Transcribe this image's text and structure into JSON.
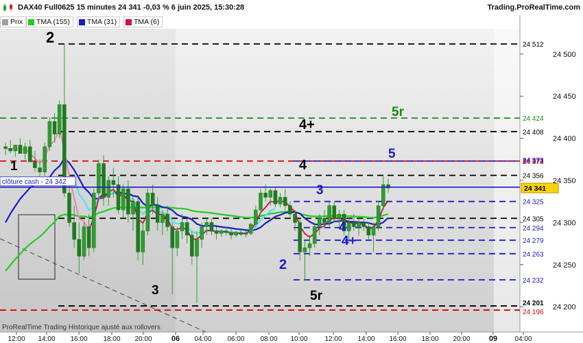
{
  "header": {
    "title": "DAX40 Full0625 15 minutes 24 341 -0,03 % 6 juin 2025, 15:30:28",
    "brand": "Trading.ProRealTime.com"
  },
  "legend": [
    {
      "label": "Prix",
      "color": "#a0a0a0"
    },
    {
      "label": "TMA (155)",
      "color": "#22cc22"
    },
    {
      "label": "TMA (31)",
      "color": "#1a1acc"
    },
    {
      "label": "TMA (6)",
      "color": "#cc1144"
    }
  ],
  "footer": {
    "text": "ProRealTime Trading  Historique ajusté aux rollovers"
  },
  "colors": {
    "candle": "#2e9e2e",
    "background": "#d9d9d9",
    "tma155": "#22cc22",
    "tma31": "#1a1acc",
    "tma6": "#cc1144",
    "cyan": "#55e0f0",
    "pink": "#f080b0"
  },
  "chart_data": {
    "type": "candlestick",
    "ylim": [
      24170,
      24530
    ],
    "y_ticks": [
      24200,
      24250,
      24300,
      24350,
      24400,
      24450,
      24500
    ],
    "x_ticks": [
      "12:00",
      "14:00",
      "16:00",
      "18:00",
      "20:00",
      "06",
      "04:00",
      "06:00",
      "08:00",
      "10:00",
      "12:00",
      "14:00",
      "16:00",
      "18:00",
      "20:00",
      "09",
      "04:00"
    ],
    "bold_x_ticks": [
      "06",
      "09"
    ],
    "price_line": {
      "label": "clôture cash -  24 342",
      "value": 24342
    },
    "current_price": 24341,
    "levels": [
      {
        "value": 24512,
        "label": "24 512",
        "color": "#000000"
      },
      {
        "value": 24424,
        "label": "24 424",
        "color": "#1a8a1a"
      },
      {
        "value": 24408,
        "label": "24 408",
        "color": "#000000"
      },
      {
        "value": 24373,
        "label": "24 373",
        "color": "#dd0000"
      },
      {
        "value": 24373,
        "label": "24 373",
        "color": "#1a1acc"
      },
      {
        "value": 24356,
        "label": "24 356",
        "color": "#000000"
      },
      {
        "value": 24325,
        "label": "24 325",
        "color": "#1a1acc"
      },
      {
        "value": 24305,
        "label": "24 305",
        "color": "#000000"
      },
      {
        "value": 24294,
        "label": "24 294",
        "color": "#1a1acc"
      },
      {
        "value": 24279,
        "label": "24 279",
        "color": "#1a1acc"
      },
      {
        "value": 24263,
        "label": "24 263",
        "color": "#1a1acc"
      },
      {
        "value": 24232,
        "label": "24 232",
        "color": "#1a1acc"
      },
      {
        "value": 24201,
        "label": "24 201",
        "color": "#000000"
      },
      {
        "value": 24196,
        "label": "24 196",
        "color": "#dd0000"
      }
    ],
    "annotations": [
      {
        "text": "2",
        "color": "#000000"
      },
      {
        "text": "1",
        "color": "#000000"
      },
      {
        "text": "3",
        "color": "#000000"
      },
      {
        "text": "5r",
        "color": "#1a8a1a"
      },
      {
        "text": "4+",
        "color": "#000000"
      },
      {
        "text": "4",
        "color": "#000000"
      },
      {
        "text": "5r",
        "color": "#000000"
      },
      {
        "text": "5",
        "color": "#1a1acc"
      },
      {
        "text": "3",
        "color": "#1a1acc"
      },
      {
        "text": "4",
        "color": "#1a1acc"
      },
      {
        "text": "4+",
        "color": "#1a1acc"
      },
      {
        "text": "2",
        "color": "#1a1acc"
      }
    ],
    "candles": [
      [
        24390,
        24395,
        24380,
        24388
      ],
      [
        24388,
        24398,
        24382,
        24385
      ],
      [
        24385,
        24390,
        24378,
        24392
      ],
      [
        24392,
        24400,
        24385,
        24382
      ],
      [
        24382,
        24395,
        24375,
        24390
      ],
      [
        24390,
        24398,
        24380,
        24372
      ],
      [
        24372,
        24385,
        24360,
        24365
      ],
      [
        24365,
        24375,
        24355,
        24360
      ],
      [
        24360,
        24395,
        24355,
        24390
      ],
      [
        24390,
        24425,
        24385,
        24420
      ],
      [
        24420,
        24430,
        24395,
        24405
      ],
      [
        24405,
        24445,
        24400,
        24440
      ],
      [
        24440,
        24512,
        24330,
        24335
      ],
      [
        24335,
        24345,
        24295,
        24300
      ],
      [
        24300,
        24320,
        24270,
        24280
      ],
      [
        24280,
        24300,
        24240,
        24260
      ],
      [
        24260,
        24300,
        24255,
        24295
      ],
      [
        24295,
        24310,
        24260,
        24270
      ],
      [
        24270,
        24340,
        24265,
        24335
      ],
      [
        24335,
        24375,
        24330,
        24370
      ],
      [
        24370,
        24380,
        24320,
        24330
      ],
      [
        24330,
        24355,
        24320,
        24350
      ],
      [
        24350,
        24365,
        24330,
        24345
      ],
      [
        24345,
        24355,
        24310,
        24315
      ],
      [
        24315,
        24345,
        24305,
        24340
      ],
      [
        24340,
        24350,
        24300,
        24310
      ],
      [
        24310,
        24330,
        24290,
        24325
      ],
      [
        24325,
        24330,
        24255,
        24265
      ],
      [
        24265,
        24300,
        24250,
        24290
      ],
      [
        24290,
        24340,
        24285,
        24335
      ],
      [
        24335,
        24345,
        24310,
        24320
      ],
      [
        24320,
        24330,
        24290,
        24300
      ],
      [
        24300,
        24315,
        24285,
        24310
      ],
      [
        24310,
        24320,
        24290,
        24295
      ],
      [
        24295,
        24300,
        24215,
        24270
      ],
      [
        24270,
        24295,
        24260,
        24290
      ],
      [
        24290,
        24310,
        24280,
        24300
      ],
      [
        24300,
        24305,
        24275,
        24285
      ],
      [
        24285,
        24290,
        24250,
        24260
      ],
      [
        24260,
        24290,
        24205,
        24280
      ],
      [
        24280,
        24300,
        24270,
        24295
      ],
      [
        24295,
        24305,
        24285,
        24300
      ],
      [
        24300,
        24305,
        24285,
        24290
      ],
      [
        24290,
        24295,
        24280,
        24287
      ],
      [
        24287,
        24292,
        24283,
        24290
      ],
      [
        24290,
        24295,
        24285,
        24288
      ],
      [
        24288,
        24292,
        24280,
        24285
      ],
      [
        24285,
        24290,
        24282,
        24288
      ],
      [
        24288,
        24292,
        24284,
        24286
      ],
      [
        24286,
        24290,
        24282,
        24287
      ],
      [
        24287,
        24300,
        24285,
        24298
      ],
      [
        24298,
        24320,
        24295,
        24315
      ],
      [
        24315,
        24340,
        24310,
        24335
      ],
      [
        24335,
        24345,
        24325,
        24330
      ],
      [
        24330,
        24340,
        24320,
        24338
      ],
      [
        24338,
        24342,
        24318,
        24322
      ],
      [
        24322,
        24335,
        24318,
        24330
      ],
      [
        24330,
        24340,
        24315,
        24320
      ],
      [
        24320,
        24325,
        24305,
        24310
      ],
      [
        24310,
        24315,
        24290,
        24300
      ],
      [
        24300,
        24305,
        24255,
        24265
      ],
      [
        24265,
        24280,
        24232,
        24270
      ],
      [
        24270,
        24285,
        24260,
        24275
      ],
      [
        24275,
        24300,
        24270,
        24295
      ],
      [
        24295,
        24310,
        24285,
        24305
      ],
      [
        24305,
        24315,
        24295,
        24300
      ],
      [
        24300,
        24325,
        24295,
        24320
      ],
      [
        24320,
        24325,
        24300,
        24305
      ],
      [
        24305,
        24315,
        24295,
        24310
      ],
      [
        24310,
        24315,
        24285,
        24290
      ],
      [
        24290,
        24305,
        24280,
        24300
      ],
      [
        24300,
        24310,
        24290,
        24295
      ],
      [
        24295,
        24305,
        24285,
        24300
      ],
      [
        24300,
        24305,
        24290,
        24295
      ],
      [
        24295,
        24300,
        24280,
        24285
      ],
      [
        24285,
        24300,
        24265,
        24295
      ],
      [
        24295,
        24325,
        24290,
        24320
      ],
      [
        24320,
        24355,
        24315,
        24345
      ],
      [
        24345,
        24352,
        24335,
        24341
      ]
    ]
  }
}
